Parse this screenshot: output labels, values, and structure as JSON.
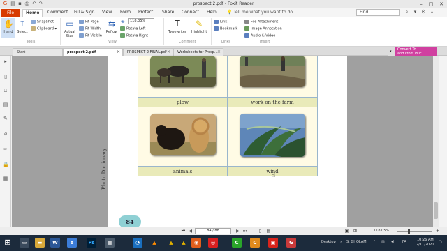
{
  "window": {
    "title": "prospect 2.pdf - Foxit Reader"
  },
  "menu": {
    "file": "File",
    "items": [
      "Home",
      "Comment",
      "Fill & Sign",
      "View",
      "Form",
      "Protect",
      "Share",
      "Connect",
      "Help"
    ],
    "active_index": 0,
    "tell_me": "Tell me what you want to do...",
    "find_placeholder": "Find"
  },
  "ribbon": {
    "hand": "Hand",
    "select": "Select",
    "snapshot": "SnapShot",
    "clipboard": "Clipboard",
    "actual_size": "Actual Size",
    "fit_page": "Fit Page",
    "fit_width": "Fit Width",
    "fit_visible": "Fit Visible",
    "reflow": "Reflow",
    "zoom_value": "118.05%",
    "rotate_left": "Rotate Left",
    "rotate_right": "Rotate Right",
    "typewriter": "Typewriter",
    "highlight": "Highlight",
    "link": "Link",
    "bookmark": "Bookmark",
    "file_attachment": "File Attachment",
    "image_annotation": "Image Annotation",
    "audio_video": "Audio & Video",
    "groups": {
      "tools": "Tools",
      "view": "View",
      "comment": "Comment",
      "links": "Links",
      "insert": "Insert"
    }
  },
  "tabs": [
    {
      "label": "Start",
      "active": false
    },
    {
      "label": "prospect 2.pdf",
      "active": true
    },
    {
      "label": "PROSPECT 2 FINAL.pdf",
      "active": false
    },
    {
      "label": "Worksheets for Prosp...",
      "active": false
    }
  ],
  "promo": {
    "line1": "Convert To",
    "line2": "and From PDF"
  },
  "document": {
    "captions": [
      "plow",
      "work on the farm",
      "animals",
      "wind"
    ],
    "side_label": "Photo Dictionary",
    "page_number": "84"
  },
  "status": {
    "page_indicator": "84 / 88",
    "zoom": "118.05%"
  },
  "taskbar": {
    "tray_label": "Desktop",
    "user": "S. GHOLAMI",
    "time": "10:26 AM",
    "date": "2/11/2021"
  },
  "colors": {
    "accent": "#d83b01",
    "caption_bg": "#e9eab9",
    "cell_bg": "#fffbe5",
    "page_badge": "#8fd0d4"
  }
}
